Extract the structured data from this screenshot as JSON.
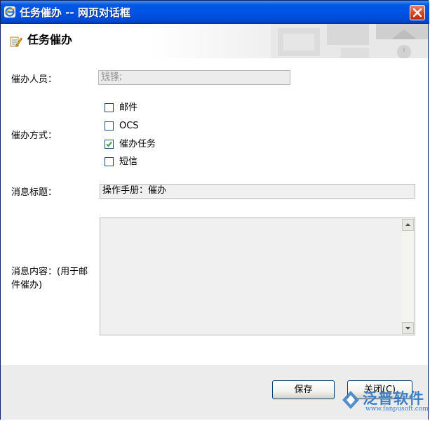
{
  "window": {
    "title": "任务催办 -- 网页对话框",
    "close_icon": "close-icon",
    "title_icon": "ie-icon"
  },
  "header": {
    "title": "任务催办",
    "icon": "task-edit-icon"
  },
  "form": {
    "recipient_label": "催办人员：",
    "recipient_value": "钱锋;",
    "method_label": "催办方式：",
    "methods": [
      {
        "label": "邮件",
        "checked": false
      },
      {
        "label": "OCS",
        "checked": false
      },
      {
        "label": "催办任务",
        "checked": true
      },
      {
        "label": "短信",
        "checked": false
      }
    ],
    "subject_label": "消息标题：",
    "subject_value": "操作手册：催办",
    "content_label_line1": "消息内容：(用于邮",
    "content_label_line2": "件催办)",
    "content_value": ""
  },
  "footer": {
    "save_label": "保存",
    "close_label": "关闭(C)"
  },
  "watermark": {
    "brand": "泛普软件",
    "url": "www.fanpusoft.com"
  },
  "colors": {
    "titlebar": "#0054e3",
    "footer_bg": "#ececec",
    "field_bg": "#f0f0f0",
    "checkbox_border": "#1c5180",
    "check_mark": "#21a121",
    "brand": "#3a7fc4"
  }
}
